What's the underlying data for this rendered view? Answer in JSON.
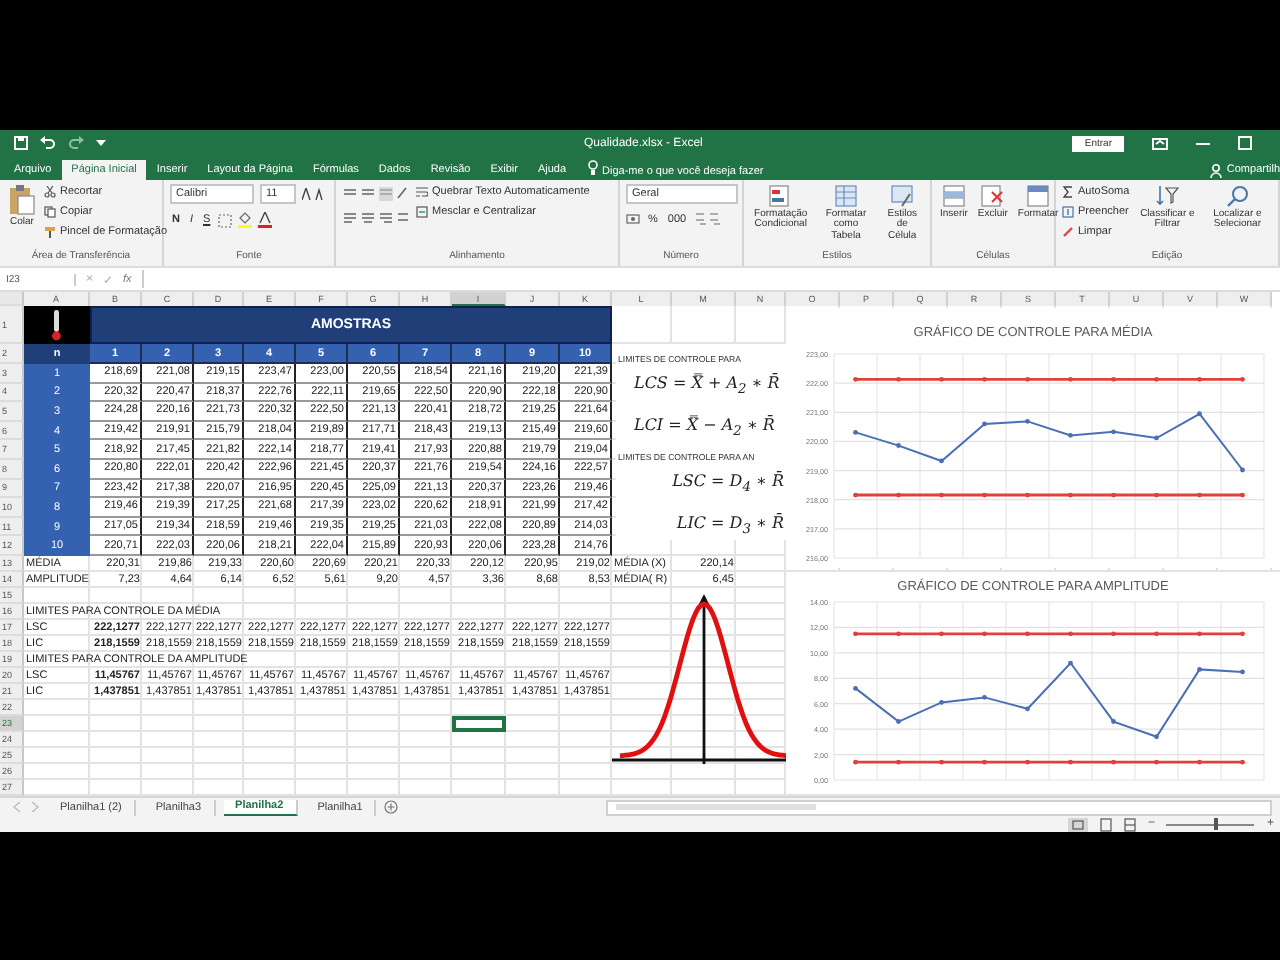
{
  "window": {
    "title": "Qualidade.xlsx - Excel",
    "sign_in": "Entrar"
  },
  "tabs": [
    {
      "label": "Arquivo",
      "selected": false
    },
    {
      "label": "Página Inicial",
      "selected": true
    },
    {
      "label": "Inserir",
      "selected": false
    },
    {
      "label": "Layout da Página",
      "selected": false
    },
    {
      "label": "Fórmulas",
      "selected": false
    },
    {
      "label": "Dados",
      "selected": false
    },
    {
      "label": "Revisão",
      "selected": false
    },
    {
      "label": "Exibir",
      "selected": false
    },
    {
      "label": "Ajuda",
      "selected": false
    }
  ],
  "tell_me": {
    "placeholder": "Diga-me o que você deseja fazer"
  },
  "share": "Compartilh",
  "ribbon": {
    "clipboard": {
      "paste": "Colar",
      "cut": "Recortar",
      "copy": "Copiar",
      "painter": "Pincel de Formatação",
      "label": "Área de Transferência"
    },
    "font": {
      "name": "Calibri",
      "size": "11",
      "bold": "N",
      "italic": "I",
      "underline": "S",
      "label": "Fonte"
    },
    "alignment": {
      "wrap": "Quebrar Texto Automaticamente",
      "merge": "Mesclar e Centralizar",
      "label": "Alinhamento"
    },
    "number": {
      "format": "Geral",
      "percent": "%",
      "thousands": "000",
      "label": "Número"
    },
    "styles": {
      "conditional": "Formatação Condicional",
      "table": "Formatar como Tabela",
      "cell": "Estilos de Célula",
      "label": "Estilos"
    },
    "cells": {
      "insert": "Inserir",
      "delete": "Excluir",
      "format": "Formatar",
      "label": "Células"
    },
    "editing": {
      "autosum": "AutoSoma",
      "fill": "Preencher",
      "clear": "Limpar",
      "sort": "Classificar e Filtrar",
      "find": "Localizar e Selecionar",
      "label": "Edição"
    }
  },
  "formula_bar": {
    "name_box": "I23",
    "cancel": "×",
    "enter": "✓",
    "function": "fx"
  },
  "sheet": {
    "columns": [
      {
        "label": "A",
        "selected": false
      },
      {
        "label": "B",
        "selected": false
      },
      {
        "label": "C",
        "selected": false
      },
      {
        "label": "D",
        "selected": false
      },
      {
        "label": "E",
        "selected": false
      },
      {
        "label": "F",
        "selected": false
      },
      {
        "label": "G",
        "selected": false
      },
      {
        "label": "H",
        "selected": false
      },
      {
        "label": "I",
        "selected": true
      },
      {
        "label": "J",
        "selected": false
      },
      {
        "label": "K",
        "selected": false
      },
      {
        "label": "L",
        "selected": false
      },
      {
        "label": "M",
        "selected": false
      },
      {
        "label": "N",
        "selected": false
      },
      {
        "label": "O",
        "selected": false
      },
      {
        "label": "P",
        "selected": false
      },
      {
        "label": "Q",
        "selected": false
      },
      {
        "label": "R",
        "selected": false
      },
      {
        "label": "S",
        "selected": false
      },
      {
        "label": "T",
        "selected": false
      },
      {
        "label": "U",
        "selected": false
      },
      {
        "label": "V",
        "selected": false
      },
      {
        "label": "W",
        "selected": false
      }
    ],
    "rows": [
      {
        "header": "1",
        "selected": false,
        "kind": "title",
        "cells": [
          "AMOSTRAS"
        ]
      },
      {
        "header": "2",
        "selected": false,
        "kind": "head",
        "cells": [
          "n",
          "1",
          "2",
          "3",
          "4",
          "5",
          "6",
          "7",
          "8",
          "9",
          "10"
        ]
      },
      {
        "header": "3",
        "selected": false,
        "kind": "sample",
        "cells": [
          "1",
          "218,69",
          "221,08",
          "219,15",
          "223,47",
          "223,00",
          "220,55",
          "218,54",
          "221,16",
          "219,20",
          "221,39"
        ]
      },
      {
        "header": "4",
        "selected": false,
        "kind": "sample",
        "cells": [
          "2",
          "220,32",
          "220,47",
          "218,37",
          "222,76",
          "222,11",
          "219,65",
          "222,50",
          "220,90",
          "222,18",
          "220,90"
        ]
      },
      {
        "header": "5",
        "selected": false,
        "kind": "sample",
        "cells": [
          "3",
          "224,28",
          "220,16",
          "221,73",
          "220,32",
          "222,50",
          "221,13",
          "220,41",
          "218,72",
          "219,25",
          "221,64"
        ]
      },
      {
        "header": "6",
        "selected": false,
        "kind": "sample",
        "cells": [
          "4",
          "219,42",
          "219,91",
          "215,79",
          "218,04",
          "219,89",
          "217,71",
          "218,43",
          "219,13",
          "215,49",
          "219,60"
        ]
      },
      {
        "header": "7",
        "selected": false,
        "kind": "sample",
        "cells": [
          "5",
          "218,92",
          "217,45",
          "221,82",
          "222,14",
          "218,77",
          "219,41",
          "217,93",
          "220,88",
          "219,79",
          "219,04"
        ]
      },
      {
        "header": "8",
        "selected": false,
        "kind": "sample",
        "cells": [
          "6",
          "220,80",
          "222,01",
          "220,42",
          "222,96",
          "221,45",
          "220,37",
          "221,76",
          "219,54",
          "224,16",
          "222,57"
        ]
      },
      {
        "header": "9",
        "selected": false,
        "kind": "sample",
        "cells": [
          "7",
          "223,42",
          "217,38",
          "220,07",
          "216,95",
          "220,45",
          "225,09",
          "221,13",
          "220,37",
          "223,26",
          "219,46"
        ]
      },
      {
        "header": "10",
        "selected": false,
        "kind": "sample",
        "cells": [
          "8",
          "219,46",
          "219,39",
          "217,25",
          "221,68",
          "217,39",
          "223,02",
          "220,62",
          "218,91",
          "221,99",
          "217,42"
        ]
      },
      {
        "header": "11",
        "selected": false,
        "kind": "sample",
        "cells": [
          "9",
          "217,05",
          "219,34",
          "218,59",
          "219,46",
          "219,35",
          "219,25",
          "221,03",
          "222,08",
          "220,89",
          "214,03"
        ]
      },
      {
        "header": "12",
        "selected": false,
        "kind": "sample",
        "cells": [
          "10",
          "220,71",
          "222,03",
          "220,06",
          "218,21",
          "222,04",
          "215,89",
          "220,93",
          "220,06",
          "223,28",
          "214,76"
        ]
      },
      {
        "header": "13",
        "selected": false,
        "kind": "summary",
        "cells": [
          "MÉDIA",
          "220,31",
          "219,86",
          "219,33",
          "220,60",
          "220,69",
          "220,21",
          "220,33",
          "220,12",
          "220,95",
          "219,02",
          "MÉDIA (X)",
          "220,14"
        ]
      },
      {
        "header": "14",
        "selected": false,
        "kind": "summary",
        "cells": [
          "AMPLITUDE",
          "7,23",
          "4,64",
          "6,14",
          "6,52",
          "5,61",
          "9,20",
          "4,57",
          "3,36",
          "8,68",
          "8,53",
          "MÉDIA( R)",
          "6,45"
        ]
      },
      {
        "header": "15",
        "selected": false,
        "kind": "blank"
      },
      {
        "header": "16",
        "selected": false,
        "kind": "section",
        "cells": [
          "LIMITES PARA CONTROLE DA MÉDIA"
        ]
      },
      {
        "header": "17",
        "selected": false,
        "kind": "limit",
        "cells": [
          "LSC",
          "222,1277",
          "222,1277",
          "222,1277",
          "222,1277",
          "222,1277",
          "222,1277",
          "222,1277",
          "222,1277",
          "222,1277",
          "222,1277"
        ]
      },
      {
        "header": "18",
        "selected": false,
        "kind": "limit",
        "cells": [
          "LIC",
          "218,1559",
          "218,1559",
          "218,1559",
          "218,1559",
          "218,1559",
          "218,1559",
          "218,1559",
          "218,1559",
          "218,1559",
          "218,1559"
        ]
      },
      {
        "header": "19",
        "selected": false,
        "kind": "section",
        "cells": [
          "LIMITES PARA CONTROLE DA AMPLITUDE"
        ]
      },
      {
        "header": "20",
        "selected": false,
        "kind": "limit",
        "cells": [
          "LSC",
          "11,45767",
          "11,45767",
          "11,45767",
          "11,45767",
          "11,45767",
          "11,45767",
          "11,45767",
          "11,45767",
          "11,45767",
          "11,45767"
        ]
      },
      {
        "header": "21",
        "selected": false,
        "kind": "limit",
        "cells": [
          "LIC",
          "1,437851",
          "1,437851",
          "1,437851",
          "1,437851",
          "1,437851",
          "1,437851",
          "1,437851",
          "1,437851",
          "1,437851",
          "1,437851"
        ]
      },
      {
        "header": "22",
        "selected": false,
        "kind": "blank"
      },
      {
        "header": "23",
        "selected": true,
        "kind": "blank"
      },
      {
        "header": "24",
        "selected": false,
        "kind": "blank"
      },
      {
        "header": "25",
        "selected": false,
        "kind": "blank"
      },
      {
        "header": "26",
        "selected": false,
        "kind": "blank"
      },
      {
        "header": "27",
        "selected": false,
        "kind": "blank"
      }
    ]
  },
  "formulas_panel": {
    "heading_1": "LIMITES DE CONTROLE PARA",
    "formulas_1": [
      "LCS = X̿ + A$_{2}$ ∗ R̄",
      "LCI = X̿ − A$_{2}$ ∗ R̄"
    ],
    "heading_2": "LIMITES DE CONTROLE PARA AN",
    "formulas_2": [
      "LSC = D$_{4}$ ∗ R̄",
      "LIC = D$_{3}$ ∗ R̄"
    ]
  },
  "charts": [
    {
      "chart_data": {
        "type": "line",
        "title": "GRÁFICO DE CONTROLE PARA MÉDIA",
        "grid": true,
        "ylim": [
          216,
          223
        ],
        "yticks": [
          {
            "value": 216,
            "label": "216,00"
          },
          {
            "value": 217,
            "label": "217,00"
          },
          {
            "value": 218,
            "label": "218,00"
          },
          {
            "value": 219,
            "label": "219,00"
          },
          {
            "value": 220,
            "label": "220,00"
          },
          {
            "value": 221,
            "label": "221,00"
          },
          {
            "value": 222,
            "label": "222,00"
          },
          {
            "value": 223,
            "label": "223,00"
          }
        ],
        "series": [
          {
            "color": "#e0403c",
            "values": [
              222.13,
              222.13,
              222.13,
              222.13,
              222.13,
              222.13,
              222.13,
              222.13,
              222.13,
              222.13
            ]
          },
          {
            "color": "#4a6fb5",
            "values": [
              220.31,
              219.86,
              219.33,
              220.6,
              220.69,
              220.21,
              220.33,
              220.12,
              220.95,
              219.02
            ]
          },
          {
            "color": "#e0403c",
            "values": [
              218.16,
              218.16,
              218.16,
              218.16,
              218.16,
              218.16,
              218.16,
              218.16,
              218.16,
              218.16
            ]
          }
        ]
      }
    },
    {
      "chart_data": {
        "type": "line",
        "title": "GRÁFICO DE CONTROLE PARA AMPLITUDE",
        "grid": true,
        "ylim": [
          0,
          14
        ],
        "yticks": [
          {
            "value": 0,
            "label": "0,00"
          },
          {
            "value": 2,
            "label": "2,00"
          },
          {
            "value": 4,
            "label": "4,00"
          },
          {
            "value": 6,
            "label": "6,00"
          },
          {
            "value": 8,
            "label": "8,00"
          },
          {
            "value": 10,
            "label": "10,00"
          },
          {
            "value": 12,
            "label": "12,00"
          },
          {
            "value": 14,
            "label": "14,00"
          }
        ],
        "series": [
          {
            "color": "#e0403c",
            "values": [
              11.5,
              11.5,
              11.5,
              11.5,
              11.5,
              11.5,
              11.5,
              11.5,
              11.5,
              11.5
            ]
          },
          {
            "color": "#4a6fb5",
            "values": [
              7.2,
              4.6,
              6.1,
              6.5,
              5.6,
              9.2,
              4.6,
              3.4,
              8.7,
              8.5
            ]
          },
          {
            "color": "#e0403c",
            "values": [
              1.4,
              1.4,
              1.4,
              1.4,
              1.4,
              1.4,
              1.4,
              1.4,
              1.4,
              1.4
            ]
          }
        ]
      }
    }
  ],
  "sheet_tabs": [
    {
      "label": "Planilha1 (2)",
      "selected": false
    },
    {
      "label": "Planilha3",
      "selected": false
    },
    {
      "label": "Planilha2",
      "selected": true
    },
    {
      "label": "Planilha1",
      "selected": false
    }
  ],
  "zoom": {
    "minus": "−",
    "plus": "+",
    "level": 0.55
  }
}
